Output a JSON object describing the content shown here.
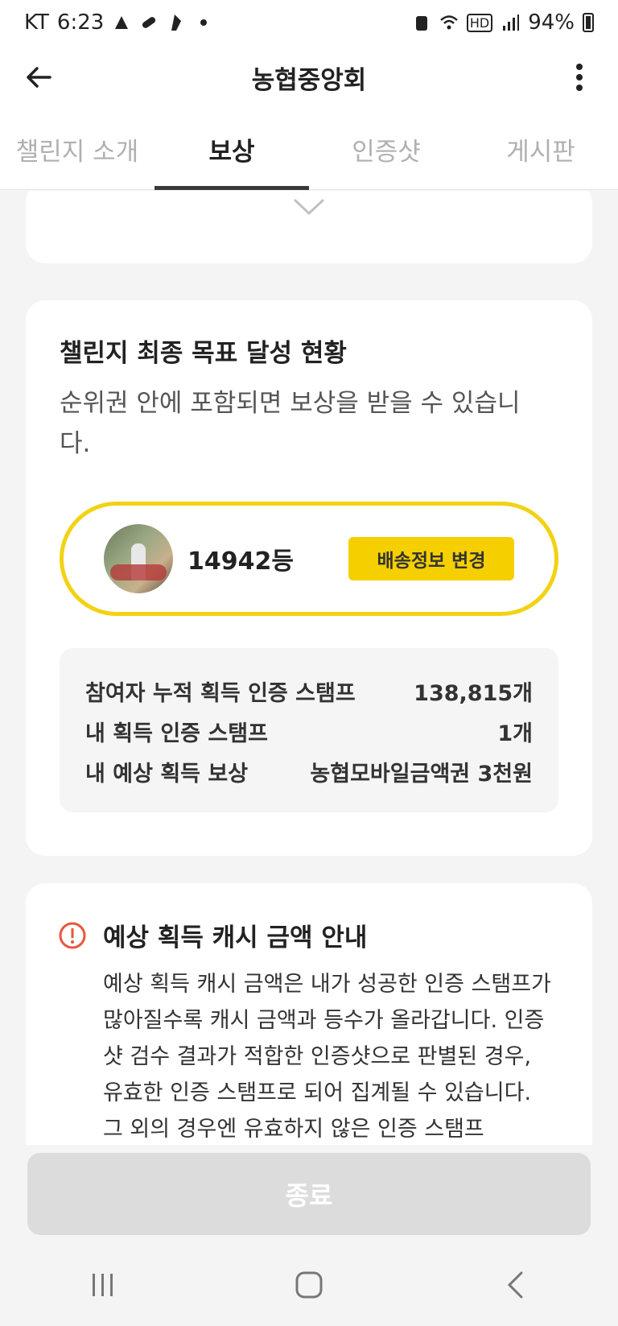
{
  "status_bar": {
    "carrier": "KT",
    "time": "6:23",
    "hd": "HD",
    "battery": "94%"
  },
  "app_bar": {
    "title": "농협중앙회"
  },
  "tabs": [
    {
      "label": "챌린지 소개",
      "active": false
    },
    {
      "label": "보상",
      "active": true
    },
    {
      "label": "인증샷",
      "active": false
    },
    {
      "label": "게시판",
      "active": false
    }
  ],
  "goal_card": {
    "title": "챌린지 최종 목표 달성 현황",
    "subtitle": "순위권 안에 포함되면 보상을 받을 수 있습니다.",
    "rank": "14942등",
    "shipping_button": "배송정보 변경",
    "stats": [
      {
        "label": "참여자 누적 획득 인증 스탬프",
        "value": "138,815개"
      },
      {
        "label": "내 획득 인증 스탬프",
        "value": "1개"
      },
      {
        "label": "내 예상 획득 보상",
        "value": "농협모바일금액권 3천원"
      }
    ]
  },
  "info_card": {
    "title": "예상 획득 캐시 금액 안내",
    "body": "예상 획득 캐시 금액은 내가 성공한 인증 스탬프가 많아질수록 캐시 금액과 등수가 올라갑니다. 인증샷 검수 결과가 적합한 인증샷으로 판별된 경우, 유효한 인증 스탬프로 되어 집계될 수 있습니다. 그 외의 경우엔 유효하지 않은 인증 스탬프"
  },
  "footer": {
    "end_button": "종료"
  },
  "colors": {
    "accent": "#f5cf00",
    "rank_border": "#f2d213",
    "info_icon": "#e8553e"
  }
}
